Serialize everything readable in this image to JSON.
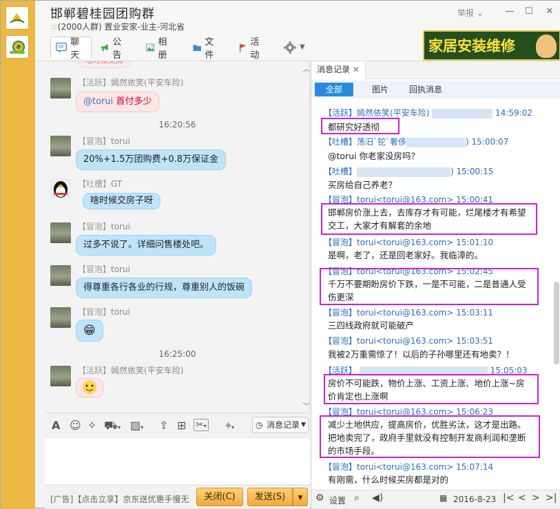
{
  "header": {
    "title": "邯郸碧桂园团购群",
    "subtitle": "(2000人群) 置业安家-业主-河北省",
    "report": "举报",
    "ad_text": "家居安装维修"
  },
  "tabs": [
    {
      "label": "聊天"
    },
    {
      "label": "公告"
    },
    {
      "label": "相册"
    },
    {
      "label": "文件"
    },
    {
      "label": "活动"
    }
  ],
  "chat": {
    "top_cutoff": "啥时候交房",
    "messages": [
      {
        "tag": "【活跃】",
        "name": "嫣然依笑(平安车险)",
        "text": "首付多少",
        "mention": "@torui"
      },
      {
        "time": "16:20:56"
      },
      {
        "tag": "【冒泡】",
        "name": "torui",
        "text": "20%+1.5万团购费+0.8万保证金"
      },
      {
        "tag": "【吐槽】",
        "name": "GT",
        "text": "啥时候交房子呀"
      },
      {
        "tag": "【冒泡】",
        "name": "torui",
        "text": "过多不说了。详细问售楼处吧。"
      },
      {
        "tag": "【冒泡】",
        "name": "torui",
        "text": "得尊重各行各业的行规，尊重别人的饭碗"
      },
      {
        "tag": "【冒泡】",
        "name": "torui",
        "text": "😁"
      },
      {
        "time": "16:25:00"
      },
      {
        "tag": "【活跃】",
        "name": "嫣然依笑(平安车险)",
        "text": ""
      }
    ]
  },
  "toolbar": {
    "msg_record": "消息记录"
  },
  "footer": {
    "ad": "[广告]【点击立享】京东送优惠手慢无",
    "close": "关闭(C)",
    "send": "发送(S)"
  },
  "record": {
    "tab": "消息记录",
    "filters": [
      "全部",
      "图片",
      "回执消息"
    ],
    "entries": [
      {
        "tag": "【活跃】",
        "name": "嫣然依笑(平安车险)",
        "time": "14:59:02",
        "text": [
          "都研究好透彻"
        ],
        "boxed": true
      },
      {
        "tag": "【吐槽】",
        "name": "荡汨`铊`奢侈",
        "time": ") 15:00:07",
        "text": [
          "@torui 你老家没房吗？"
        ]
      },
      {
        "tag": "【吐槽】",
        "name": "",
        "time": ") 15:00:15",
        "text": [
          "买房给自己养老？"
        ]
      },
      {
        "tag": "【冒泡】",
        "name": "torui<torui@163.com>",
        "time": "15:00:41",
        "text": [
          "邯郸房价涨上去，去库存才有可能，烂尾楼才有希望",
          "交工，大家才有解套的余地"
        ],
        "boxed": true
      },
      {
        "tag": "【冒泡】",
        "name": "torui<torui@163.com>",
        "time": "15:01:10",
        "text": [
          "是啊，老了，还是回老家好。我临漳的。"
        ]
      },
      {
        "tag": "【冒泡】",
        "name": "torui<torui@163.com>",
        "time": "15:02:45",
        "text": [
          "千万不要期盼房价下跌，一是不可能，二是普通人受",
          "伤更深"
        ],
        "boxed": true
      },
      {
        "tag": "【冒泡】",
        "name": "torui<torui@163.com>",
        "time": "15:03:11",
        "text": [
          "三四线政府就可能破产"
        ]
      },
      {
        "tag": "【冒泡】",
        "name": "torui<torui@163.com>",
        "time": "15:03:51",
        "text": [
          "我被2万重需惊了！以后的子孙哪里还有地卖？！"
        ]
      },
      {
        "tag": "【活跃】",
        "name": "",
        "time": "15:05:03",
        "text": [
          "房价不可能跌，物价上涨、工资上涨、地价上涨~房",
          "价肯定也上涨啊"
        ],
        "boxed": true
      },
      {
        "tag": "【冒泡】",
        "name": "torui<torui@163.com>",
        "time": "15:06:23",
        "text": [
          "减少土地供应，提高房价，优胜劣汰，这才是出路。",
          "把地卖完了，政府手里就没有控制开发商利润和垄断",
          "的市场手段。"
        ],
        "boxed": true
      },
      {
        "tag": "【冒泡】",
        "name": "torui<torui@163.com>",
        "time": "15:07:14",
        "text": [
          "有刚需，什么时候买房都是对的"
        ]
      }
    ],
    "footer": {
      "settings": "设置",
      "date": "2016-8-23"
    }
  }
}
